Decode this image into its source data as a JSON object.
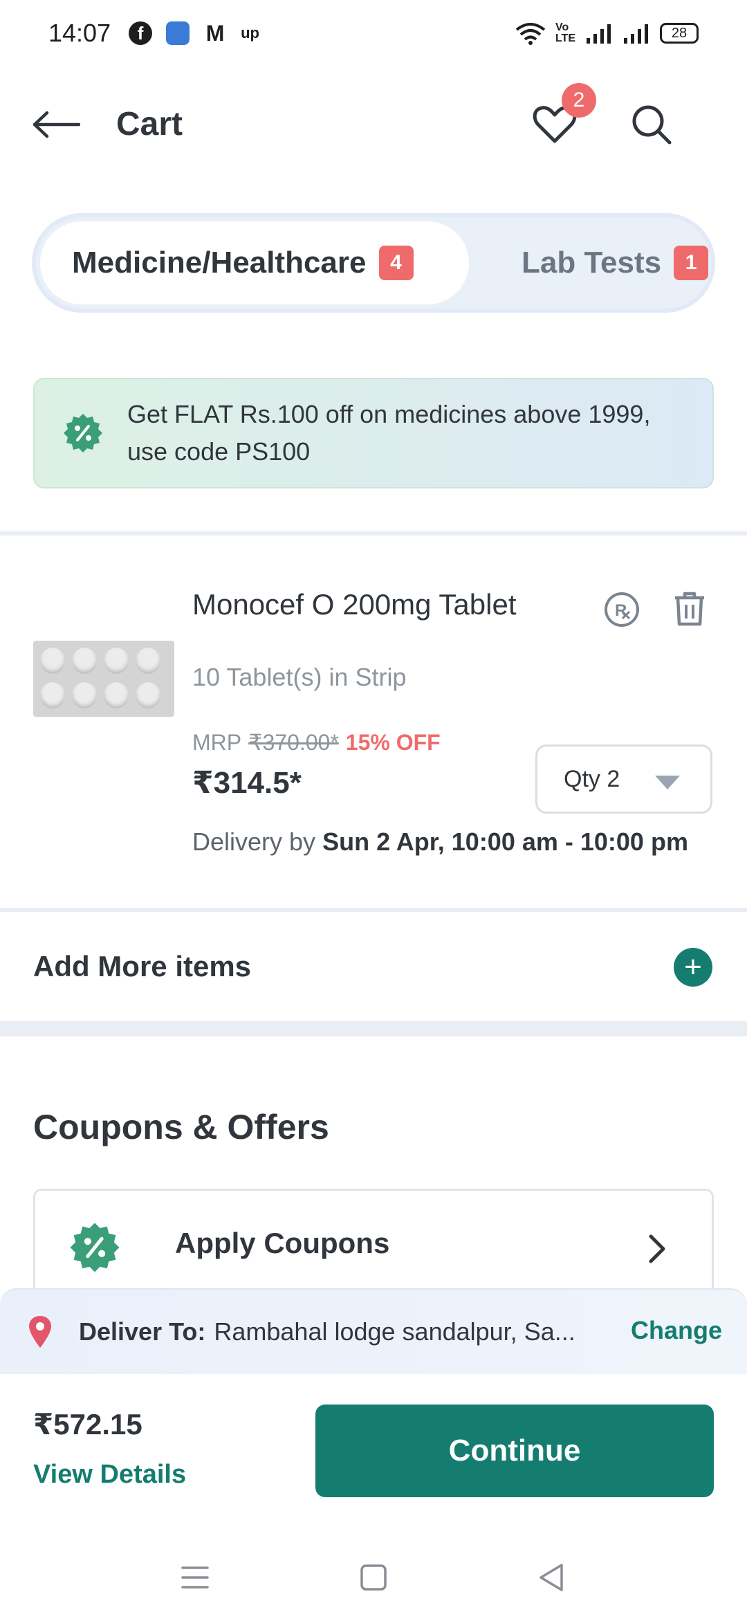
{
  "status_bar": {
    "time": "14:07",
    "apps": [
      "facebook-icon",
      "app-icon",
      "gmail-icon",
      "up-icon"
    ],
    "up_label": "up",
    "volte": "Vo\nLTE",
    "battery": "28"
  },
  "header": {
    "title": "Cart",
    "wishlist_count": "2"
  },
  "tabs": [
    {
      "label": "Medicine/Healthcare",
      "count": "4"
    },
    {
      "label": "Lab Tests",
      "count": "1"
    }
  ],
  "promo": {
    "text": "Get FLAT Rs.100 off on medicines above 1999, use code PS100"
  },
  "item": {
    "name": "Monocef O 200mg Tablet",
    "pack": "10 Tablet(s) in Strip",
    "mrp_label": "MRP",
    "mrp": "₹370.00*",
    "discount": "15% OFF",
    "price": "₹314.5*",
    "qty": "Qty 2",
    "delivery_prefix": "Delivery by",
    "delivery_time": "Sun 2 Apr, 10:00 am - 10:00 pm"
  },
  "add_more": {
    "label": "Add More items"
  },
  "coupons": {
    "title": "Coupons & Offers",
    "apply_label": "Apply Coupons"
  },
  "deliver": {
    "label": "Deliver To:",
    "address": "Rambahal lodge sandalpur, Sa...",
    "change": "Change"
  },
  "footer": {
    "total": "₹572.15",
    "view_details": "View Details",
    "continue": "Continue"
  },
  "colors": {
    "brand": "#147d6f",
    "badge": "#ef6b6b",
    "text": "#30363c"
  }
}
